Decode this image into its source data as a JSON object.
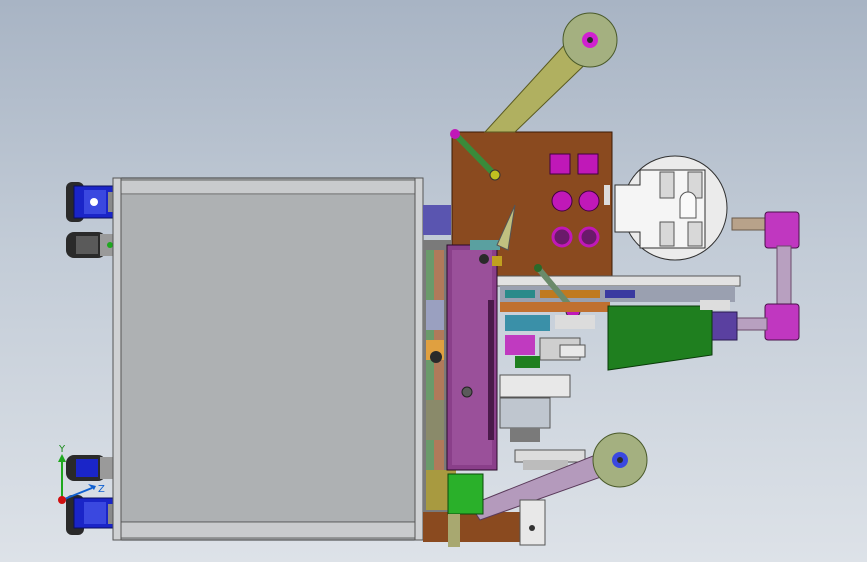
{
  "viewport": {
    "background_top": "#a8b4c4",
    "background_bottom": "#dde2e8"
  },
  "triad": {
    "y_label": "Y",
    "z_label": "Z",
    "y_color": "#1fa81f",
    "x_color": "#d01010",
    "z_color": "#1060d0"
  },
  "colors": {
    "housing": "#b9bcbe",
    "mounting_plate": "#8a4a1f",
    "magenta": "#c018b8",
    "violet_panel": "#8a3f8a",
    "olive_arm": "#b0b060",
    "green_block": "#1f7f1f",
    "purple_pipe": "#c037c0",
    "caster_blue": "#1a25c8"
  },
  "icons": {
    "reel": "film-reel-icon",
    "caster": "caster-wheel-icon",
    "triad": "coordinate-triad-icon"
  }
}
